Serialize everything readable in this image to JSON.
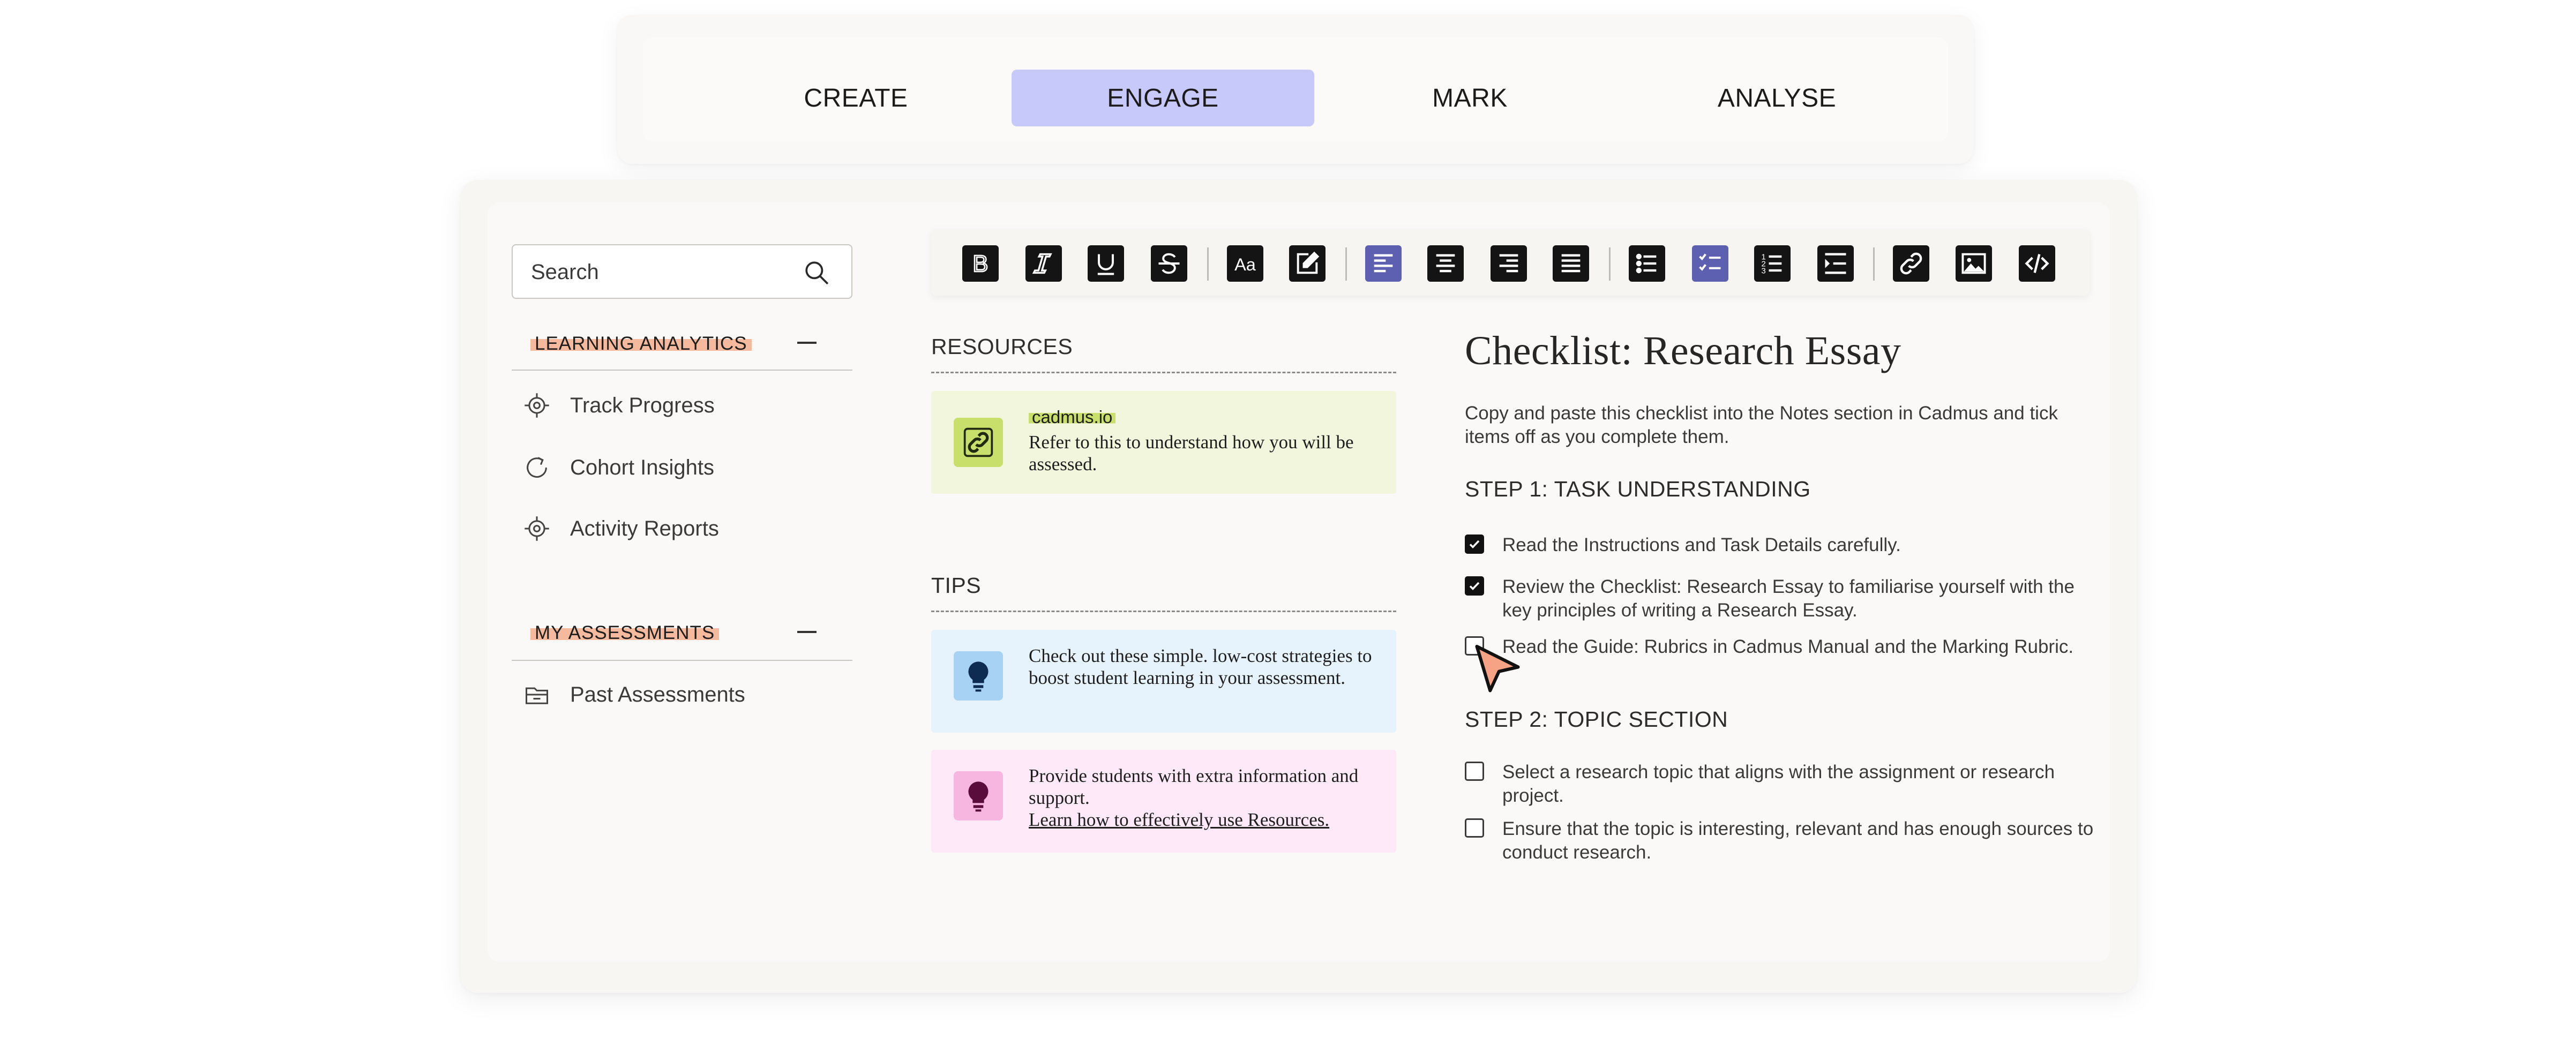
{
  "tabs": [
    {
      "label": "CREATE",
      "active": false
    },
    {
      "label": "ENGAGE",
      "active": true
    },
    {
      "label": "MARK",
      "active": false
    },
    {
      "label": "ANALYSE",
      "active": false
    }
  ],
  "sidebar": {
    "search_placeholder": "Search",
    "sections": [
      {
        "label": "LEARNING ANALYTICS",
        "items": [
          {
            "label": "Track Progress",
            "icon": "target-icon"
          },
          {
            "label": "Cohort Insights",
            "icon": "refresh-icon"
          },
          {
            "label": "Activity Reports",
            "icon": "target-icon"
          }
        ]
      },
      {
        "label": "MY ASSESSMENTS",
        "items": [
          {
            "label": "Past Assessments",
            "icon": "folder-icon"
          }
        ]
      }
    ]
  },
  "toolbar": {
    "buttons": [
      {
        "name": "bold",
        "icon": "bold-icon",
        "active": false
      },
      {
        "name": "italic",
        "icon": "italic-icon",
        "active": false
      },
      {
        "name": "underline",
        "icon": "underline-icon",
        "active": false
      },
      {
        "name": "strikethrough",
        "icon": "strikethrough-icon",
        "active": false
      },
      {
        "name": "font-size",
        "icon": "font-size-icon",
        "active": false
      },
      {
        "name": "edit",
        "icon": "edit-icon",
        "active": false
      },
      {
        "name": "align-left",
        "icon": "align-left-icon",
        "active": true
      },
      {
        "name": "align-center",
        "icon": "align-center-icon",
        "active": false
      },
      {
        "name": "align-right",
        "icon": "align-right-icon",
        "active": false
      },
      {
        "name": "justify",
        "icon": "justify-icon",
        "active": false
      },
      {
        "name": "bullet-list",
        "icon": "bullet-list-icon",
        "active": false
      },
      {
        "name": "checklist",
        "icon": "checklist-icon",
        "active": true
      },
      {
        "name": "numbered-list",
        "icon": "numbered-list-icon",
        "active": false
      },
      {
        "name": "indent",
        "icon": "indent-icon",
        "active": false
      },
      {
        "name": "link",
        "icon": "link-icon",
        "active": false
      },
      {
        "name": "image",
        "icon": "image-icon",
        "active": false
      },
      {
        "name": "code",
        "icon": "code-icon",
        "active": false
      }
    ]
  },
  "resources": {
    "heading": "RESOURCES",
    "card": {
      "link_label": "cadmus.io",
      "text": "Refer to this to understand how you will be assessed.",
      "icon": "link-icon",
      "bg": "#f1f6dc",
      "icon_bg": "#c9df6c"
    }
  },
  "tips": {
    "heading": "TIPS",
    "cards": [
      {
        "text": "Check out these simple. low-cost strategies to boost student learning in your assessment.",
        "link": "",
        "icon": "lightbulb-icon",
        "bg": "#e6f3fd",
        "icon_bg": "#a8d2f3",
        "icon_color": "#0e2b52"
      },
      {
        "text": "Provide students with extra information and support.",
        "link": "Learn how to effectively use Resources.",
        "icon": "lightbulb-icon",
        "bg": "#fde9f7",
        "icon_bg": "#f6b6e0",
        "icon_color": "#5a0c3c"
      }
    ]
  },
  "checklist": {
    "title": "Checklist: Research Essay",
    "intro": "Copy and paste this checklist into the Notes section in Cadmus and tick items off as you complete them.",
    "steps": [
      {
        "heading": "STEP 1: TASK UNDERSTANDING",
        "items": [
          {
            "text": "Read the Instructions and Task Details carefully.",
            "checked": true
          },
          {
            "text": "Review the Checklist: Research Essay to familiarise yourself with the key principles of writing a Research Essay.",
            "checked": true
          },
          {
            "text": "Read the Guide: Rubrics in Cadmus Manual and the Marking Rubric.",
            "checked": false
          }
        ]
      },
      {
        "heading": "STEP 2: TOPIC SECTION",
        "items": [
          {
            "text": "Select a research topic that aligns with the assignment or research project.",
            "checked": false
          },
          {
            "text": "Ensure that the topic is interesting, relevant and has enough sources to conduct research.",
            "checked": false
          }
        ]
      }
    ]
  },
  "colors": {
    "active_tab": "#c7c9fa",
    "toolbar_active": "#5d5fb0",
    "section_highlight": "#f5b99d",
    "cursor": "#f6a385"
  }
}
